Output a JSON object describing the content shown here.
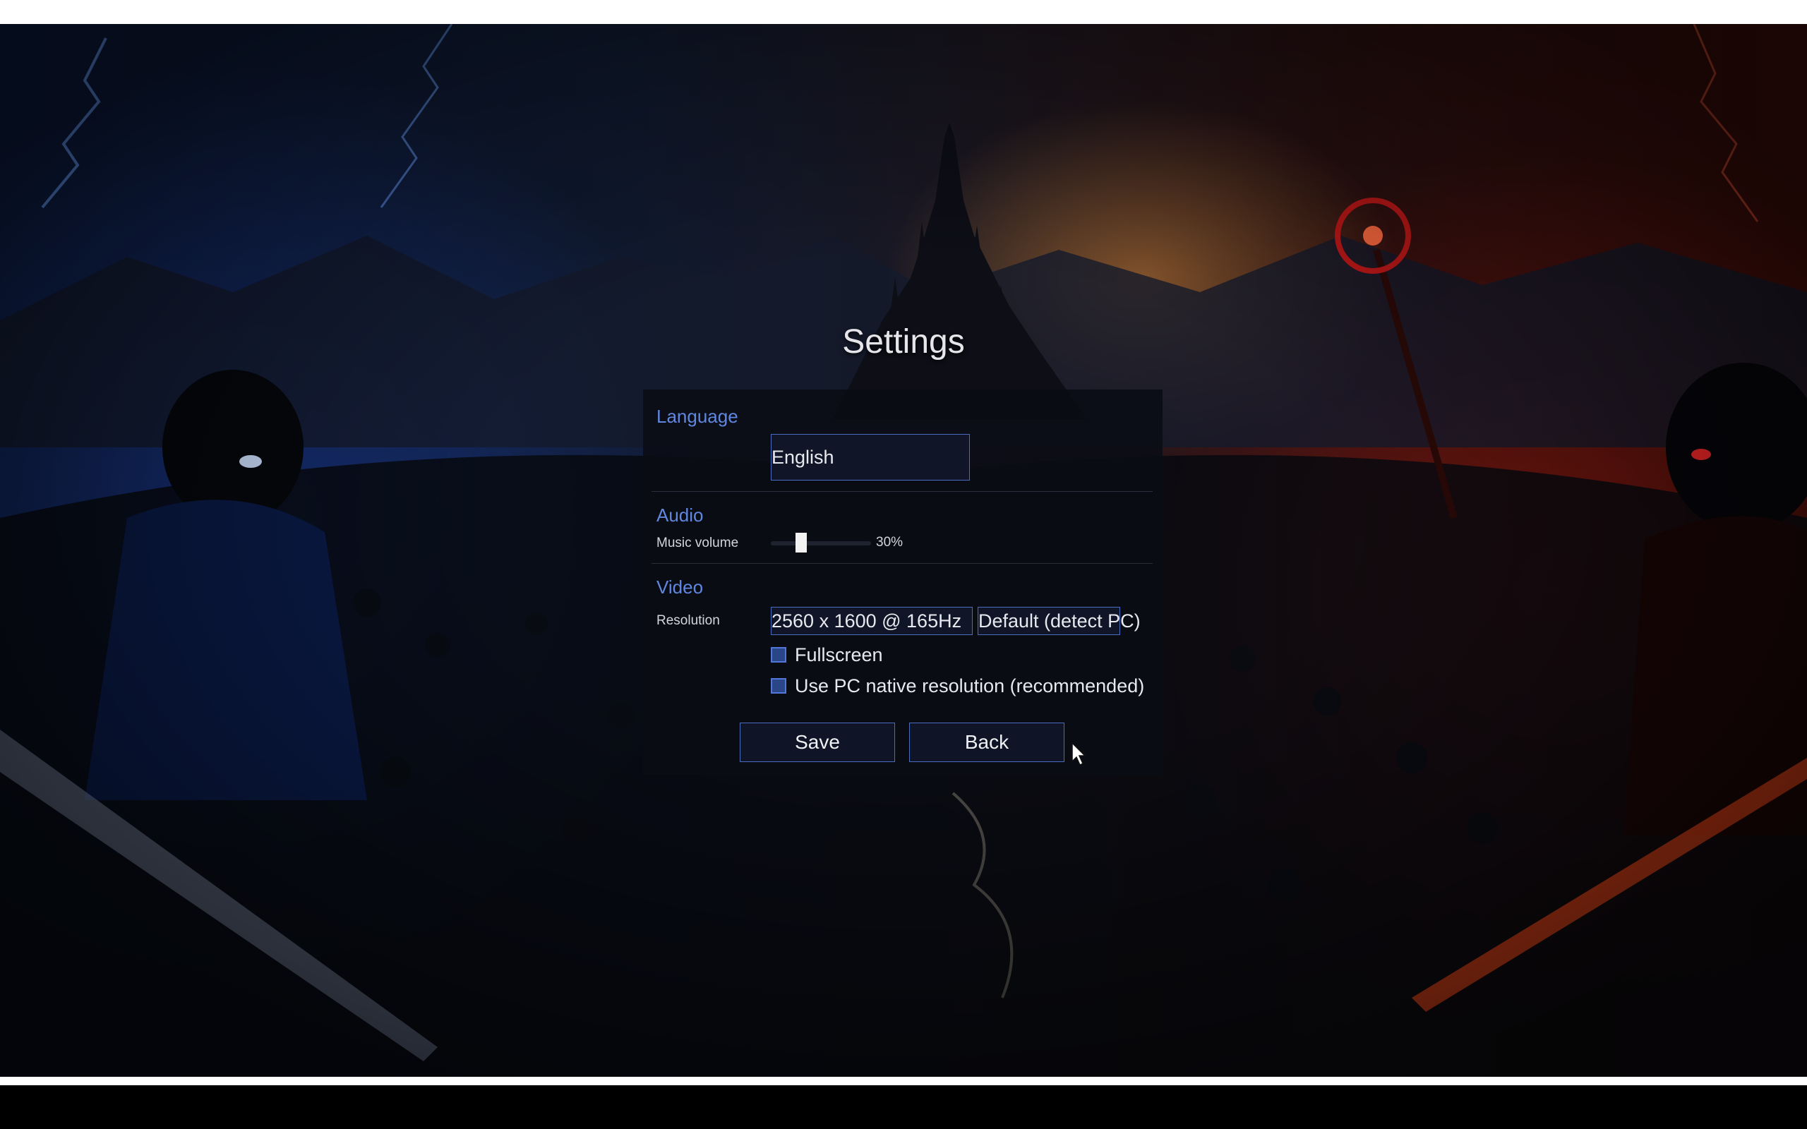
{
  "settings": {
    "title": "Settings",
    "language": {
      "section_title": "Language",
      "selected": "English"
    },
    "audio": {
      "section_title": "Audio",
      "music_volume_label": "Music volume",
      "music_volume_value": "30%",
      "music_volume_fraction": 0.3
    },
    "video": {
      "section_title": "Video",
      "resolution_label": "Resolution",
      "resolution_value": "2560 x 1600 @ 165Hz",
      "resolution_mode": "Default (detect PC)",
      "fullscreen_label": "Fullscreen",
      "fullscreen_checked": false,
      "native_resolution_label": "Use PC native resolution (recommended)",
      "native_resolution_checked": false
    },
    "buttons": {
      "save_label": "Save",
      "back_label": "Back"
    }
  },
  "colors": {
    "accent": "#5f87e0",
    "field_border": "#4a6cc0",
    "panel_bg": "#0a0c14"
  },
  "icons": {
    "cursor": "mouse-pointer-icon"
  }
}
